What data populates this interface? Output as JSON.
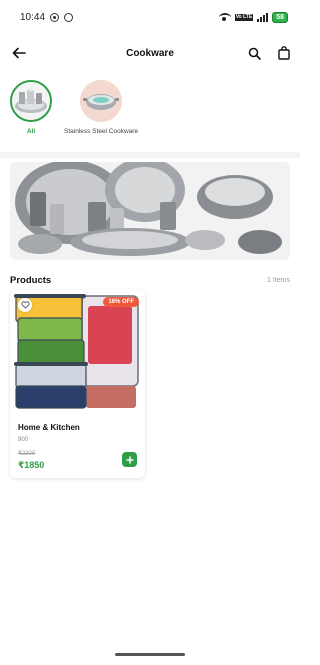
{
  "status_bar": {
    "time": "10:44",
    "vo_label": "Vo LTE",
    "battery": "58"
  },
  "header": {
    "title": "Cookware",
    "icons": [
      "back-arrow-icon",
      "search-icon",
      "shopping-bag-icon"
    ]
  },
  "categories": [
    {
      "label": "All",
      "selected": true,
      "icon": "steel-utensils-set"
    },
    {
      "label": "Stainless Steel Cookware",
      "selected": false,
      "icon": "steel-kadai"
    }
  ],
  "banner": {
    "image": "stainless-steel-utensils-banner"
  },
  "products_section": {
    "title": "Products",
    "count_label": "1 Items"
  },
  "products": [
    {
      "name": "Home & Kitchen",
      "weight": "900",
      "old_price": "₹2200",
      "price": "₹1850",
      "discount": "16% OFF",
      "image": "food-storage-containers"
    }
  ],
  "colors": {
    "accent": "#2e9e46",
    "discount": "#f05a3a",
    "battery": "#2db14a"
  }
}
